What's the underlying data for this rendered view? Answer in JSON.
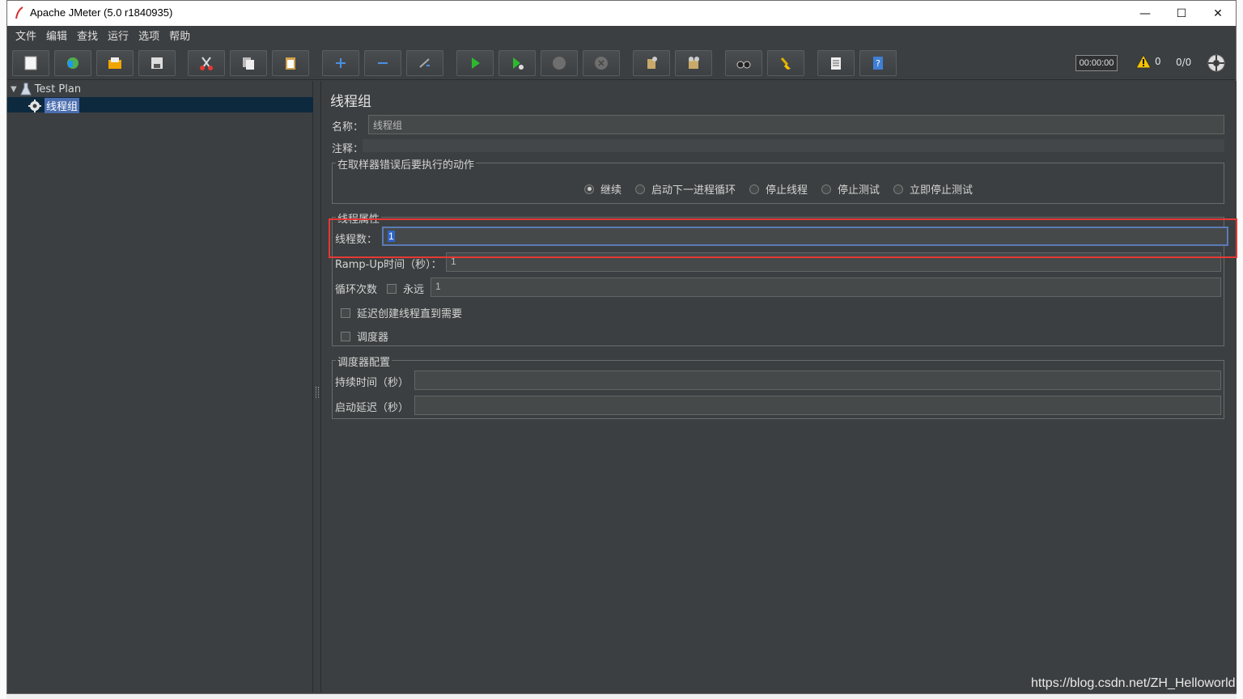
{
  "window": {
    "title": "Apache JMeter (5.0 r1840935)",
    "minimize": "—",
    "maximize": "☐",
    "close": "✕"
  },
  "menu": [
    "文件",
    "编辑",
    "查找",
    "运行",
    "选项",
    "帮助"
  ],
  "toolbar": {
    "timer": "00:00:00",
    "warning_count": "0",
    "thread_count": "0/0"
  },
  "tree": {
    "root": "Test Plan",
    "selected": "线程组"
  },
  "panel": {
    "title": "线程组",
    "name_label": "名称：",
    "name_value": "线程组",
    "comment_label": "注释：",
    "on_error": {
      "legend": "在取样器错误后要执行的动作",
      "options": [
        "继续",
        "启动下一进程循环",
        "停止线程",
        "停止测试",
        "立即停止测试"
      ],
      "selected_index": 0
    },
    "thread_props": {
      "legend": "线程属性",
      "threads_label": "线程数：",
      "threads_value": "1",
      "rampup_label": "Ramp-Up时间（秒）：",
      "rampup_value": "1",
      "loop_label": "循环次数",
      "forever_label": "永远",
      "loop_value": "1",
      "delay_label": "延迟创建线程直到需要",
      "scheduler_label": "调度器"
    },
    "scheduler": {
      "legend": "调度器配置",
      "duration_label": "持续时间（秒）",
      "delay_label": "启动延迟（秒）"
    }
  },
  "watermark": "https://blog.csdn.net/ZH_Helloworld"
}
